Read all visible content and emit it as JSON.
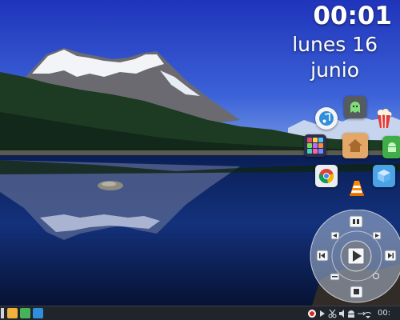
{
  "clock": {
    "time": "00:01",
    "day": "lunes 16",
    "month": "junio"
  },
  "desktop": {
    "icons": [
      "music-player-icon",
      "ghost-app-icon",
      "popcorn-app-icon",
      "app-grid-icon",
      "home-folder-icon",
      "android-file-transfer-icon",
      "chrome-browser-icon",
      "vlc-player-icon",
      "flatpak-store-icon"
    ],
    "colors": {
      "sky": "#2a44c8",
      "accent": "#2f8fdb"
    }
  },
  "media_player": {
    "controls": [
      "stop-button",
      "play-button",
      "previous-button",
      "next-button",
      "skip-back-button",
      "skip-forward-button",
      "volume-button",
      "menu-button"
    ],
    "state": "paused"
  },
  "taskbar": {
    "apps": [
      "launcher-icon",
      "files-icon",
      "terminal-icon"
    ],
    "tray": [
      "record-icon",
      "play-icon",
      "scissors-icon",
      "volume-icon",
      "android-icon",
      "network-icon",
      "usb-icon",
      "wifi-icon"
    ],
    "time": "00:"
  }
}
